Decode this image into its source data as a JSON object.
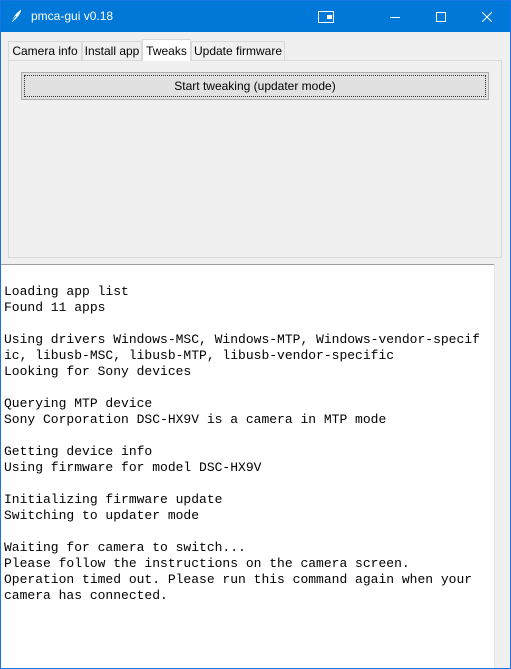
{
  "window": {
    "title": "pmca-gui v0.18"
  },
  "tabs": [
    {
      "label": "Camera info",
      "active": false
    },
    {
      "label": "Install app",
      "active": false
    },
    {
      "label": "Tweaks",
      "active": true
    },
    {
      "label": "Update firmware",
      "active": false
    }
  ],
  "tweaks": {
    "start_button_label": "Start tweaking (updater mode)"
  },
  "log": {
    "lines": [
      "Loading app list",
      "Found 11 apps",
      "",
      "Using drivers Windows-MSC, Windows-MTP, Windows-vendor-specif",
      "ic, libusb-MSC, libusb-MTP, libusb-vendor-specific",
      "Looking for Sony devices",
      "",
      "Querying MTP device",
      "Sony Corporation DSC-HX9V is a camera in MTP mode",
      "",
      "Getting device info",
      "Using firmware for model DSC-HX9V",
      "",
      "Initializing firmware update",
      "Switching to updater mode",
      "",
      "Waiting for camera to switch...",
      "Please follow the instructions on the camera screen.",
      "Operation timed out. Please run this command again when your",
      "camera has connected."
    ]
  },
  "colors": {
    "titlebar": "#0078d7",
    "window_bg": "#f0f0f0",
    "log_bg": "#ffffff"
  },
  "icons": {
    "app_icon": "feather-icon",
    "special_button": "keyboard-window-icon",
    "minimize": "minimize-icon",
    "maximize": "maximize-icon",
    "close": "close-icon"
  }
}
